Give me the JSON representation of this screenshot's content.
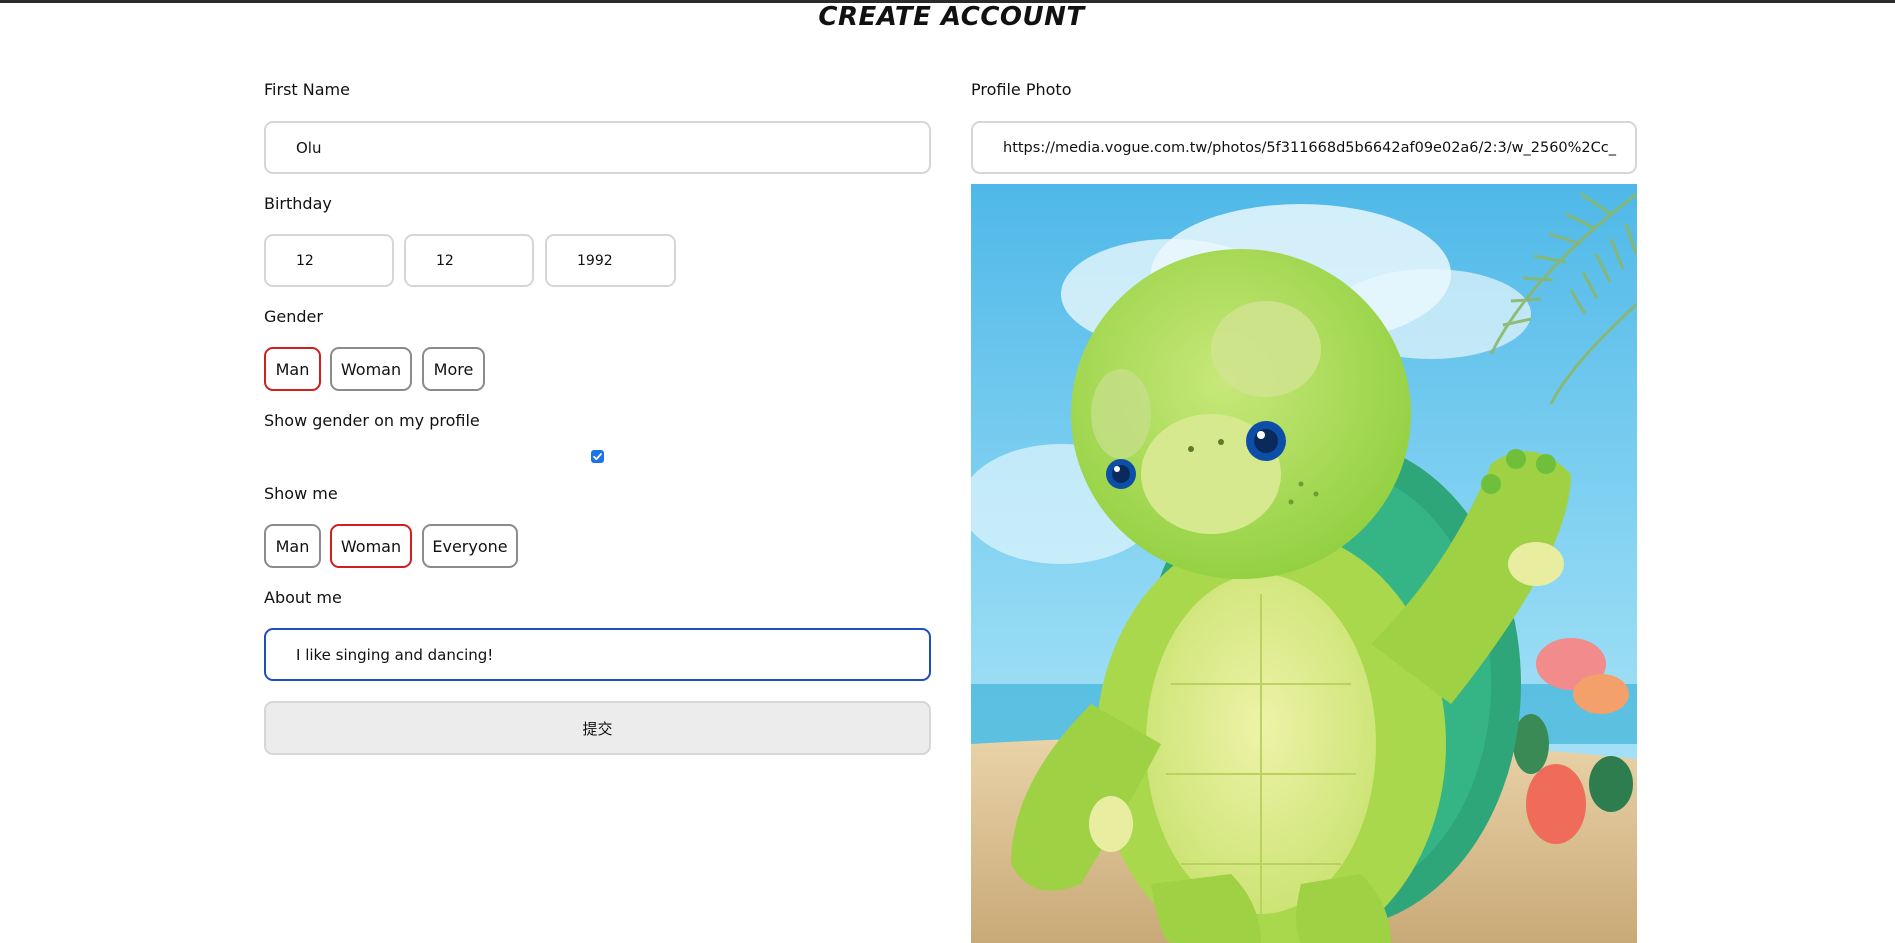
{
  "header": {
    "title": "CREATE ACCOUNT"
  },
  "form": {
    "first_name": {
      "label": "First Name",
      "value": "Olu"
    },
    "birthday": {
      "label": "Birthday",
      "day": "12",
      "month": "12",
      "year": "1992"
    },
    "gender": {
      "label": "Gender",
      "options": [
        "Man",
        "Woman",
        "More"
      ],
      "selected": "Man"
    },
    "show_gender": {
      "label": "Show gender on my profile",
      "checked": true
    },
    "show_me": {
      "label": "Show me",
      "options": [
        "Man",
        "Woman",
        "Everyone"
      ],
      "selected": "Woman"
    },
    "about": {
      "label": "About me",
      "value": "I like singing and dancing!"
    },
    "submit_label": "提交"
  },
  "profile_photo": {
    "label": "Profile Photo",
    "url": "https://media.vogue.com.tw/photos/5f311668d5b6642af09e02a6/2:3/w_2560%2Cc_"
  },
  "colors": {
    "selected_border": "#cf1f1f",
    "focus_border": "#1f4fbf",
    "checkbox": "#1a73e8"
  }
}
